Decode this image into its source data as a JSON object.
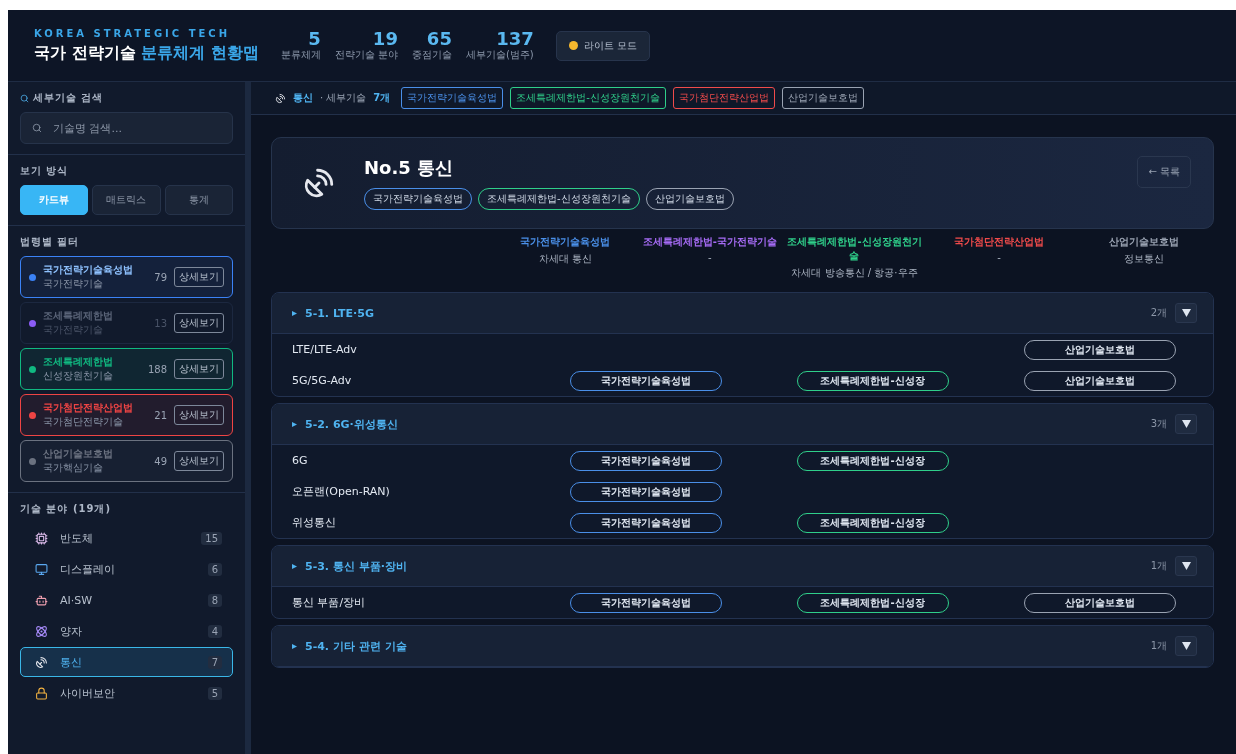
{
  "header": {
    "eyebrow": "KOREA STRATEGIC TECH",
    "title_plain": "국가 전략기술",
    "title_accent": "분류체계 현황맵",
    "stats": [
      {
        "value": "5",
        "label": "분류체계"
      },
      {
        "value": "19",
        "label": "전략기술 분야"
      },
      {
        "value": "65",
        "label": "중점기술"
      },
      {
        "value": "137",
        "label": "세부기술(범주)"
      }
    ],
    "mode_button": "라이트 모드"
  },
  "sidebar": {
    "search": {
      "heading": "세부기술 검색",
      "placeholder": "기술명 검색..."
    },
    "view": {
      "heading": "보기 방식",
      "options": [
        {
          "label": "카드뷰",
          "selected": true
        },
        {
          "label": "매트릭스",
          "selected": false
        },
        {
          "label": "통계",
          "selected": false
        }
      ]
    },
    "filters": {
      "heading": "법령별 필터",
      "items": [
        {
          "name": "국가전략기술육성법",
          "sub": "국가전략기술",
          "count": "79",
          "button": "상세보기",
          "color": "#3b82f6",
          "enabled": true
        },
        {
          "name": "조세특례제한법",
          "sub": "국가전략기술",
          "count": "13",
          "button": "상세보기",
          "color": "#8b5cf6",
          "enabled": false
        },
        {
          "name": "조세특례제한법",
          "sub": "신성장원천기술",
          "count": "188",
          "button": "상세보기",
          "color": "#10b981",
          "enabled": true
        },
        {
          "name": "국가첨단전략산업법",
          "sub": "국가첨단전략기술",
          "count": "21",
          "button": "상세보기",
          "color": "#ef4444",
          "enabled": true
        },
        {
          "name": "산업기술보호법",
          "sub": "국가핵심기술",
          "count": "49",
          "button": "상세보기",
          "color": "#6b7280",
          "enabled": true
        }
      ]
    },
    "categories": {
      "heading": "기술 분야 (19개)",
      "items": [
        {
          "name": "반도체",
          "count": "15",
          "selected": false
        },
        {
          "name": "디스플레이",
          "count": "6",
          "selected": false
        },
        {
          "name": "AI·SW",
          "count": "8",
          "selected": false
        },
        {
          "name": "양자",
          "count": "4",
          "selected": false
        },
        {
          "name": "통신",
          "count": "7",
          "selected": true
        },
        {
          "name": "사이버보안",
          "count": "5",
          "selected": false
        }
      ]
    }
  },
  "breadcrumb": {
    "topic": "통신",
    "label": "· 세부기술",
    "count": "7개",
    "tags": [
      {
        "label": "국가전략기술육성법",
        "kind": "national"
      },
      {
        "label": "조세특례제한법-신성장원천기술",
        "kind": "tax"
      },
      {
        "label": "국가첨단전략산업법",
        "kind": "advanced"
      },
      {
        "label": "산업기술보호법",
        "kind": "protect"
      }
    ]
  },
  "card": {
    "title": "No.5 통신",
    "back_button": "← 목록",
    "tags": [
      {
        "label": "국가전략기술육성법",
        "kind": "national"
      },
      {
        "label": "조세특례제한법-신성장원천기술",
        "kind": "tax"
      },
      {
        "label": "산업기술보호법",
        "kind": "protect"
      }
    ]
  },
  "law_columns": [
    {
      "name": "국가전략기술육성법",
      "value": "차세대 통신",
      "kind": "national"
    },
    {
      "name": "조세특례제한법-국가전략기술",
      "value": "-",
      "kind": "taxnational"
    },
    {
      "name": "조세특례제한법-신성장원천기술",
      "value": "차세대 방송통신 / 항공·우주",
      "kind": "tax"
    },
    {
      "name": "국가첨단전략산업법",
      "value": "-",
      "kind": "advanced"
    },
    {
      "name": "산업기술보호법",
      "value": "정보통신",
      "kind": "protect"
    }
  ],
  "sections": [
    {
      "title": "5-1. LTE·5G",
      "count": "2개",
      "rows": [
        {
          "name": "LTE/LTE-Adv",
          "tags": [
            {
              "label": "산업기술보호법",
              "kind": "protect"
            }
          ]
        },
        {
          "name": "5G/5G-Adv",
          "tags": [
            {
              "label": "국가전략기술육성법",
              "kind": "national"
            },
            {
              "label": "조세특례제한법-신성장",
              "kind": "tax"
            },
            {
              "label": "산업기술보호법",
              "kind": "protect"
            }
          ]
        }
      ]
    },
    {
      "title": "5-2. 6G·위성통신",
      "count": "3개",
      "rows": [
        {
          "name": "6G",
          "tags": [
            {
              "label": "국가전략기술육성법",
              "kind": "national"
            },
            {
              "label": "조세특례제한법-신성장",
              "kind": "tax"
            }
          ]
        },
        {
          "name": "오픈랜(Open-RAN)",
          "tags": [
            {
              "label": "국가전략기술육성법",
              "kind": "national"
            }
          ]
        },
        {
          "name": "위성통신",
          "tags": [
            {
              "label": "국가전략기술육성법",
              "kind": "national"
            },
            {
              "label": "조세특례제한법-신성장",
              "kind": "tax"
            }
          ]
        }
      ]
    },
    {
      "title": "5-3. 통신 부품·장비",
      "count": "1개",
      "rows": [
        {
          "name": "통신 부품/장비",
          "tags": [
            {
              "label": "국가전략기술육성법",
              "kind": "national"
            },
            {
              "label": "조세특례제한법-신성장",
              "kind": "tax"
            },
            {
              "label": "산업기술보호법",
              "kind": "protect"
            }
          ]
        }
      ]
    },
    {
      "title": "5-4. 기타 관련 기술",
      "count": "1개"
    }
  ]
}
